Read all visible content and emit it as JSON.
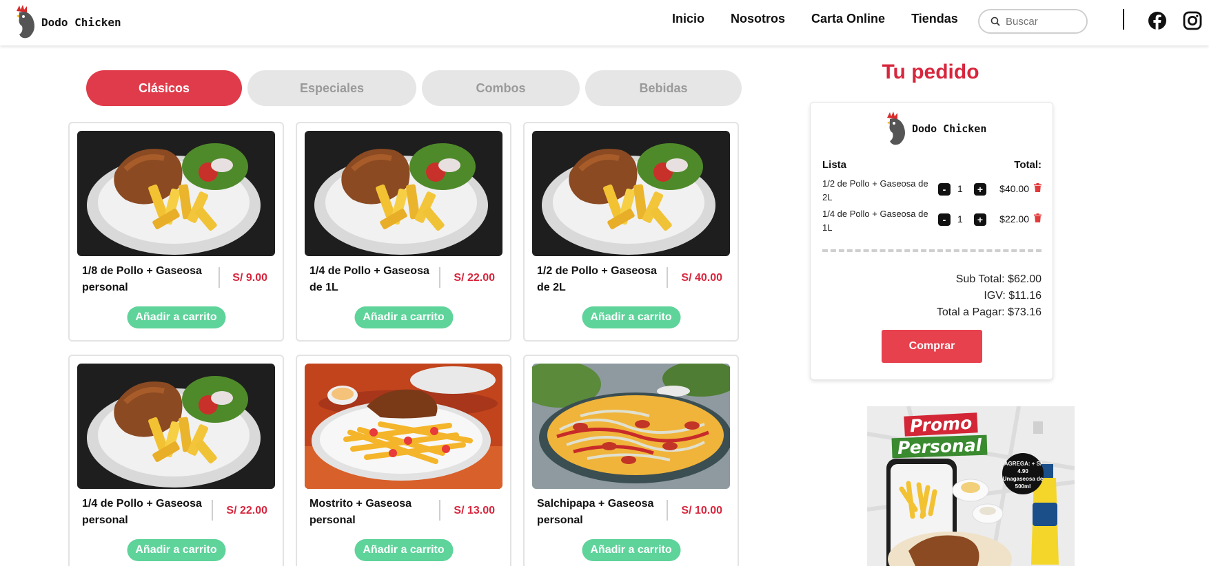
{
  "header": {
    "brand": "Dodo Chicken",
    "nav": [
      "Inicio",
      "Nosotros",
      "Carta Online",
      "Tiendas"
    ],
    "search_placeholder": "Buscar"
  },
  "tabs": [
    "Clásicos",
    "Especiales",
    "Combos",
    "Bebidas"
  ],
  "active_tab": "Clásicos",
  "products": [
    {
      "name": "1/8 de Pollo + Gaseosa personal",
      "price": "S/ 9.00",
      "button": "Añadir a carrito",
      "image": "pollo-papas"
    },
    {
      "name": "1/4 de Pollo + Gaseosa de 1L",
      "price": "S/ 22.00",
      "button": "Añadir a carrito",
      "image": "pollo-papas"
    },
    {
      "name": "1/2 de Pollo + Gaseosa de 2L",
      "price": "S/ 40.00",
      "button": "Añadir a carrito",
      "image": "pollo-papas"
    },
    {
      "name": "1/4 de Pollo + Gaseosa personal",
      "price": "S/ 22.00",
      "button": "Añadir a carrito",
      "image": "pollo-papas"
    },
    {
      "name": "Mostrito + Gaseosa personal",
      "price": "S/ 13.00",
      "button": "Añadir a carrito",
      "image": "mostrito"
    },
    {
      "name": "Salchipapa + Gaseosa personal",
      "price": "S/ 10.00",
      "button": "Añadir a carrito",
      "image": "salchipapa"
    }
  ],
  "order": {
    "title": "Tu pedido",
    "brand": "Dodo Chicken",
    "list_label": "Lista",
    "total_label": "Total:",
    "items": [
      {
        "name": "1/2 de Pollo + Gaseosa de 2L",
        "qty": "1",
        "total": "$40.00"
      },
      {
        "name": "1/4 de Pollo + Gaseosa de 1L",
        "qty": "1",
        "total": "$22.00"
      }
    ],
    "minus": "-",
    "plus": "+",
    "subtotal": "Sub Total: $62.00",
    "igv": "IGV: $11.16",
    "total": "Total a Pagar: $73.16",
    "buy": "Comprar"
  },
  "promo": {
    "line1": "Promo",
    "line2": "Personal",
    "badge": "AGREGA: + S/ 4.90 Unagaseosa de 500ml"
  },
  "colors": {
    "accent_red": "#e03b4a",
    "price_red": "#d7263d",
    "add_green": "#5ed39a",
    "tab_inactive": "#e6e6e6"
  }
}
